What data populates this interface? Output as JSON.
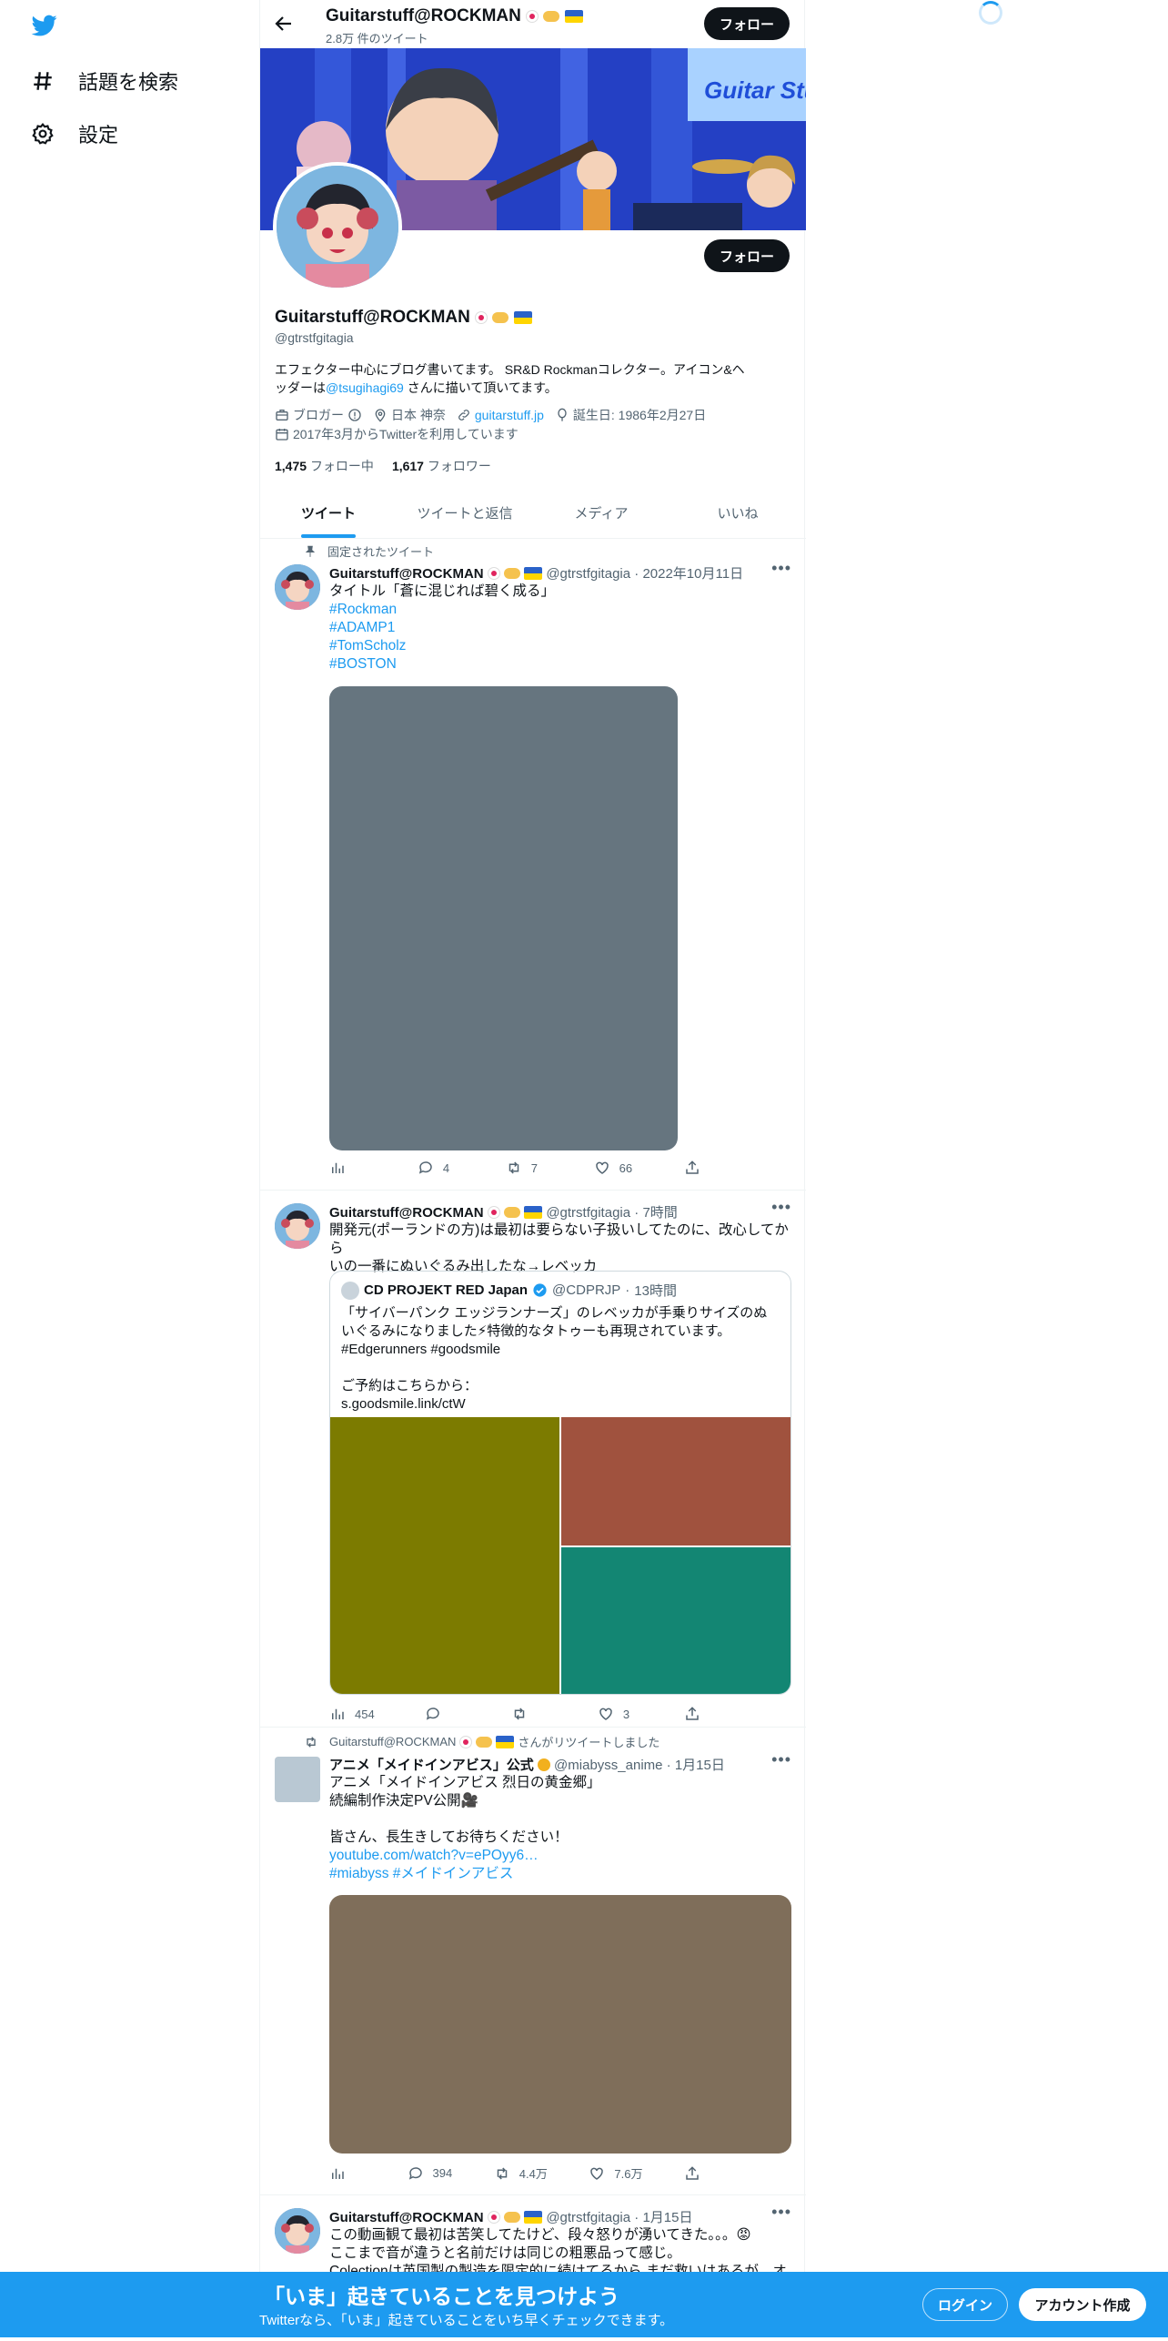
{
  "nav": {
    "explore_label": "話題を検索",
    "settings_label": "設定"
  },
  "header": {
    "name": "Guitarstuff@ROCKMAN",
    "tweet_count": "2.8万 件のツイート",
    "follow_label": "フォロー"
  },
  "banner": {
    "blog_text": "Guitar Stuff Blog"
  },
  "profile": {
    "follow_label": "フォロー",
    "name": "Guitarstuff@ROCKMAN",
    "handle": "@gtrstfgitagia",
    "bio_1": "エフェクター中心にブログ書いてます。 SR&D Rockmanコレクター。アイコン&ヘ",
    "bio_2_pre": "ッダーは",
    "bio_2_link": "@tsugihagi69",
    "bio_2_post": " さんに描いて頂いてます。",
    "category": "ブロガー",
    "location": "日本 神奈",
    "url": "guitarstuff.jp",
    "birthday": "誕生日: 1986年2月27日",
    "joined": "2017年3月からTwitterを利用しています",
    "following_count": "1,475",
    "following_label": "フォロー中",
    "followers_count": "1,617",
    "followers_label": "フォロワー"
  },
  "tabs": [
    "ツイート",
    "ツイートと返信",
    "メディア",
    "いいね"
  ],
  "tweets": [
    {
      "context": "固定されたツイート",
      "name": "Guitarstuff@ROCKMAN",
      "handle": "@gtrstfgitagia",
      "time": "2022年10月11日",
      "text": "タイトル「蒼に混じれば碧く成る」",
      "hashtags": [
        "#Rockman",
        "#ADAMP1",
        "#TomScholz",
        "#BOSTON"
      ],
      "media_color": "#66757f",
      "replies": "4",
      "retweets": "7",
      "likes": "66",
      "views": ""
    },
    {
      "name": "Guitarstuff@ROCKMAN",
      "handle": "@gtrstfgitagia",
      "time": "7時間",
      "text_1": "開発元(ポーランドの方)は最初は要らない子扱いしてたのに、改心してから",
      "text_2": "いの一番にぬいぐるみ出したな→レベッカ",
      "quote": {
        "name": "CD PROJEKT RED Japan",
        "handle": "@CDPRJP",
        "time": "13時間",
        "line_1": "「サイバーパンク エッジランナーズ」のレベッカが手乗りサイズのぬ",
        "line_2": "いぐるみになりました⚡特徴的なタトゥーも再現されています。",
        "line_3": "#Edgerunners #goodsmile",
        "line_4": "ご予約はこちらから：",
        "line_5": "s.goodsmile.link/ctW",
        "media_colors": [
          "#7c7b00",
          "#a0523e",
          "#138673"
        ]
      },
      "views": "454",
      "replies": "",
      "retweets": "",
      "likes": "3"
    },
    {
      "context": "Guitarstuff@ROCKMAN",
      "context_suffix": "さんがリツイートしました",
      "name": "アニメ「メイドインアビス」公式",
      "handle": "@miabyss_anime",
      "time": "1月15日",
      "text_1": "アニメ「メイドインアビス 烈日の黄金郷」",
      "text_2": "続編制作決定PV公開🎥",
      "text_3": "皆さん、長生きしてお待ちください！",
      "link": "youtube.com/watch?v=ePOyy6…",
      "hashtags": "#miabyss #メイドインアビス",
      "media_color": "#7f6e5a",
      "replies": "394",
      "retweets": "4.4万",
      "likes": "7.6万",
      "views": ""
    },
    {
      "name": "Guitarstuff@ROCKMAN",
      "handle": "@gtrstfgitagia",
      "time": "1月15日",
      "text_1": "この動画観て最初は苦笑してたけど、段々怒りが湧いてきた。。。😡",
      "text_2": "ここまで音が違うと名前だけは同じの粗悪品って感じ。",
      "text_3": "Colectionは英国製の製造を限定的に続けてるから まだ救いはあるが…オク"
    }
  ],
  "bottom_bar": {
    "title": "「いま」起きていることを見つけよう",
    "subtitle": "Twitterなら、「いま」起きていることをいち早くチェックできます。",
    "login_label": "ログイン",
    "signup_label": "アカウント作成"
  },
  "colors": {
    "accent": "#1d9bf0",
    "text": "#0f1419",
    "muted": "#536471"
  }
}
